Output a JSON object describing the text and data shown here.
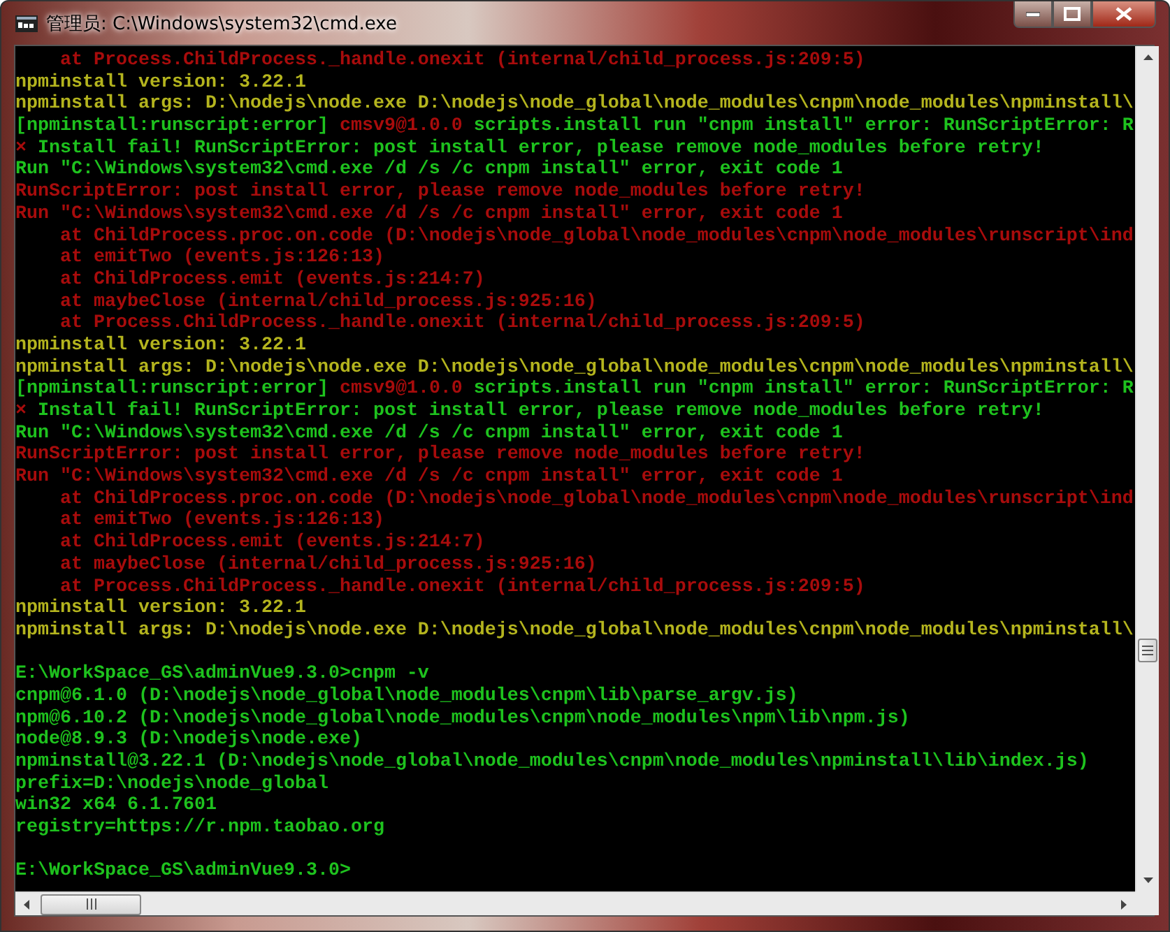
{
  "window": {
    "title": "管理员: C:\\Windows\\system32\\cmd.exe"
  },
  "console": {
    "lines": [
      {
        "kind": "text",
        "segments": [
          {
            "text": "    at Process.ChildProcess._handle.onexit (internal/child_process.js:209:5)",
            "color": "#a80c0c"
          }
        ]
      },
      {
        "kind": "text",
        "segments": [
          {
            "text": "npminstall version: 3.22.1",
            "color": "#b4b41e"
          }
        ]
      },
      {
        "kind": "text",
        "segments": [
          {
            "text": "npminstall args: D:\\nodejs\\node.exe D:\\nodejs\\node_global\\node_modules\\cnpm\\node_modules\\npminstall\\",
            "color": "#b4b41e"
          }
        ]
      },
      {
        "kind": "text",
        "segments": [
          {
            "text": "[npminstall:runscript:error] ",
            "color": "#1ec21e"
          },
          {
            "text": "cmsv9@1.0.0",
            "color": "#a80c0c"
          },
          {
            "text": " scripts.install run \"cnpm install\" error: RunScriptError: R",
            "color": "#1ec21e"
          }
        ]
      },
      {
        "kind": "text",
        "segments": [
          {
            "text": "×",
            "color": "#a80c0c"
          },
          {
            "text": " Install fail! RunScriptError: post install error, please remove node_modules before retry!",
            "color": "#1ec21e"
          }
        ]
      },
      {
        "kind": "text",
        "segments": [
          {
            "text": "Run \"C:\\Windows\\system32\\cmd.exe /d /s /c cnpm install\" error, exit code 1",
            "color": "#1ec21e"
          }
        ]
      },
      {
        "kind": "text",
        "segments": [
          {
            "text": "RunScriptError: post install error, please remove node_modules before retry!",
            "color": "#a80c0c"
          }
        ]
      },
      {
        "kind": "text",
        "segments": [
          {
            "text": "Run \"C:\\Windows\\system32\\cmd.exe /d /s /c cnpm install\" error, exit code 1",
            "color": "#a80c0c"
          }
        ]
      },
      {
        "kind": "text",
        "segments": [
          {
            "text": "    at ChildProcess.proc.on.code (D:\\nodejs\\node_global\\node_modules\\cnpm\\node_modules\\runscript\\ind",
            "color": "#a80c0c"
          }
        ]
      },
      {
        "kind": "text",
        "segments": [
          {
            "text": "    at emitTwo (events.js:126:13)",
            "color": "#a80c0c"
          }
        ]
      },
      {
        "kind": "text",
        "segments": [
          {
            "text": "    at ChildProcess.emit (events.js:214:7)",
            "color": "#a80c0c"
          }
        ]
      },
      {
        "kind": "text",
        "segments": [
          {
            "text": "    at maybeClose (internal/child_process.js:925:16)",
            "color": "#a80c0c"
          }
        ]
      },
      {
        "kind": "text",
        "segments": [
          {
            "text": "    at Process.ChildProcess._handle.onexit (internal/child_process.js:209:5)",
            "color": "#a80c0c"
          }
        ]
      },
      {
        "kind": "text",
        "segments": [
          {
            "text": "npminstall version: 3.22.1",
            "color": "#b4b41e"
          }
        ]
      },
      {
        "kind": "text",
        "segments": [
          {
            "text": "npminstall args: D:\\nodejs\\node.exe D:\\nodejs\\node_global\\node_modules\\cnpm\\node_modules\\npminstall\\",
            "color": "#b4b41e"
          }
        ]
      },
      {
        "kind": "text",
        "segments": [
          {
            "text": "[npminstall:runscript:error] ",
            "color": "#1ec21e"
          },
          {
            "text": "cmsv9@1.0.0",
            "color": "#a80c0c"
          },
          {
            "text": " scripts.install run \"cnpm install\" error: RunScriptError: R",
            "color": "#1ec21e"
          }
        ]
      },
      {
        "kind": "text",
        "segments": [
          {
            "text": "×",
            "color": "#a80c0c"
          },
          {
            "text": " Install fail! RunScriptError: post install error, please remove node_modules before retry!",
            "color": "#1ec21e"
          }
        ]
      },
      {
        "kind": "text",
        "segments": [
          {
            "text": "Run \"C:\\Windows\\system32\\cmd.exe /d /s /c cnpm install\" error, exit code 1",
            "color": "#1ec21e"
          }
        ]
      },
      {
        "kind": "text",
        "segments": [
          {
            "text": "RunScriptError: post install error, please remove node_modules before retry!",
            "color": "#a80c0c"
          }
        ]
      },
      {
        "kind": "text",
        "segments": [
          {
            "text": "Run \"C:\\Windows\\system32\\cmd.exe /d /s /c cnpm install\" error, exit code 1",
            "color": "#a80c0c"
          }
        ]
      },
      {
        "kind": "text",
        "segments": [
          {
            "text": "    at ChildProcess.proc.on.code (D:\\nodejs\\node_global\\node_modules\\cnpm\\node_modules\\runscript\\ind",
            "color": "#a80c0c"
          }
        ]
      },
      {
        "kind": "text",
        "segments": [
          {
            "text": "    at emitTwo (events.js:126:13)",
            "color": "#a80c0c"
          }
        ]
      },
      {
        "kind": "text",
        "segments": [
          {
            "text": "    at ChildProcess.emit (events.js:214:7)",
            "color": "#a80c0c"
          }
        ]
      },
      {
        "kind": "text",
        "segments": [
          {
            "text": "    at maybeClose (internal/child_process.js:925:16)",
            "color": "#a80c0c"
          }
        ]
      },
      {
        "kind": "text",
        "segments": [
          {
            "text": "    at Process.ChildProcess._handle.onexit (internal/child_process.js:209:5)",
            "color": "#a80c0c"
          }
        ]
      },
      {
        "kind": "text",
        "segments": [
          {
            "text": "npminstall version: 3.22.1",
            "color": "#b4b41e"
          }
        ]
      },
      {
        "kind": "text",
        "segments": [
          {
            "text": "npminstall args: D:\\nodejs\\node.exe D:\\nodejs\\node_global\\node_modules\\cnpm\\node_modules\\npminstall\\",
            "color": "#b4b41e"
          }
        ]
      },
      {
        "kind": "blank"
      },
      {
        "kind": "text",
        "segments": [
          {
            "text": "E:\\WorkSpace_GS\\adminVue9.3.0>cnpm -v",
            "color": "#1ec21e"
          }
        ]
      },
      {
        "kind": "text",
        "segments": [
          {
            "text": "cnpm@6.1.0 (D:\\nodejs\\node_global\\node_modules\\cnpm\\lib\\parse_argv.js)",
            "color": "#1ec21e"
          }
        ]
      },
      {
        "kind": "text",
        "segments": [
          {
            "text": "npm@6.10.2 (D:\\nodejs\\node_global\\node_modules\\cnpm\\node_modules\\npm\\lib\\npm.js)",
            "color": "#1ec21e"
          }
        ]
      },
      {
        "kind": "text",
        "segments": [
          {
            "text": "node@8.9.3 (D:\\nodejs\\node.exe)",
            "color": "#1ec21e"
          }
        ]
      },
      {
        "kind": "text",
        "segments": [
          {
            "text": "npminstall@3.22.1 (D:\\nodejs\\node_global\\node_modules\\cnpm\\node_modules\\npminstall\\lib\\index.js)",
            "color": "#1ec21e"
          }
        ]
      },
      {
        "kind": "text",
        "segments": [
          {
            "text": "prefix=D:\\nodejs\\node_global",
            "color": "#1ec21e"
          }
        ]
      },
      {
        "kind": "text",
        "segments": [
          {
            "text": "win32 x64 6.1.7601",
            "color": "#1ec21e"
          }
        ]
      },
      {
        "kind": "text",
        "segments": [
          {
            "text": "registry=https://r.npm.taobao.org",
            "color": "#1ec21e"
          }
        ]
      },
      {
        "kind": "blank"
      },
      {
        "kind": "text",
        "segments": [
          {
            "text": "E:\\WorkSpace_GS\\adminVue9.3.0>",
            "color": "#1ec21e"
          }
        ]
      }
    ]
  }
}
